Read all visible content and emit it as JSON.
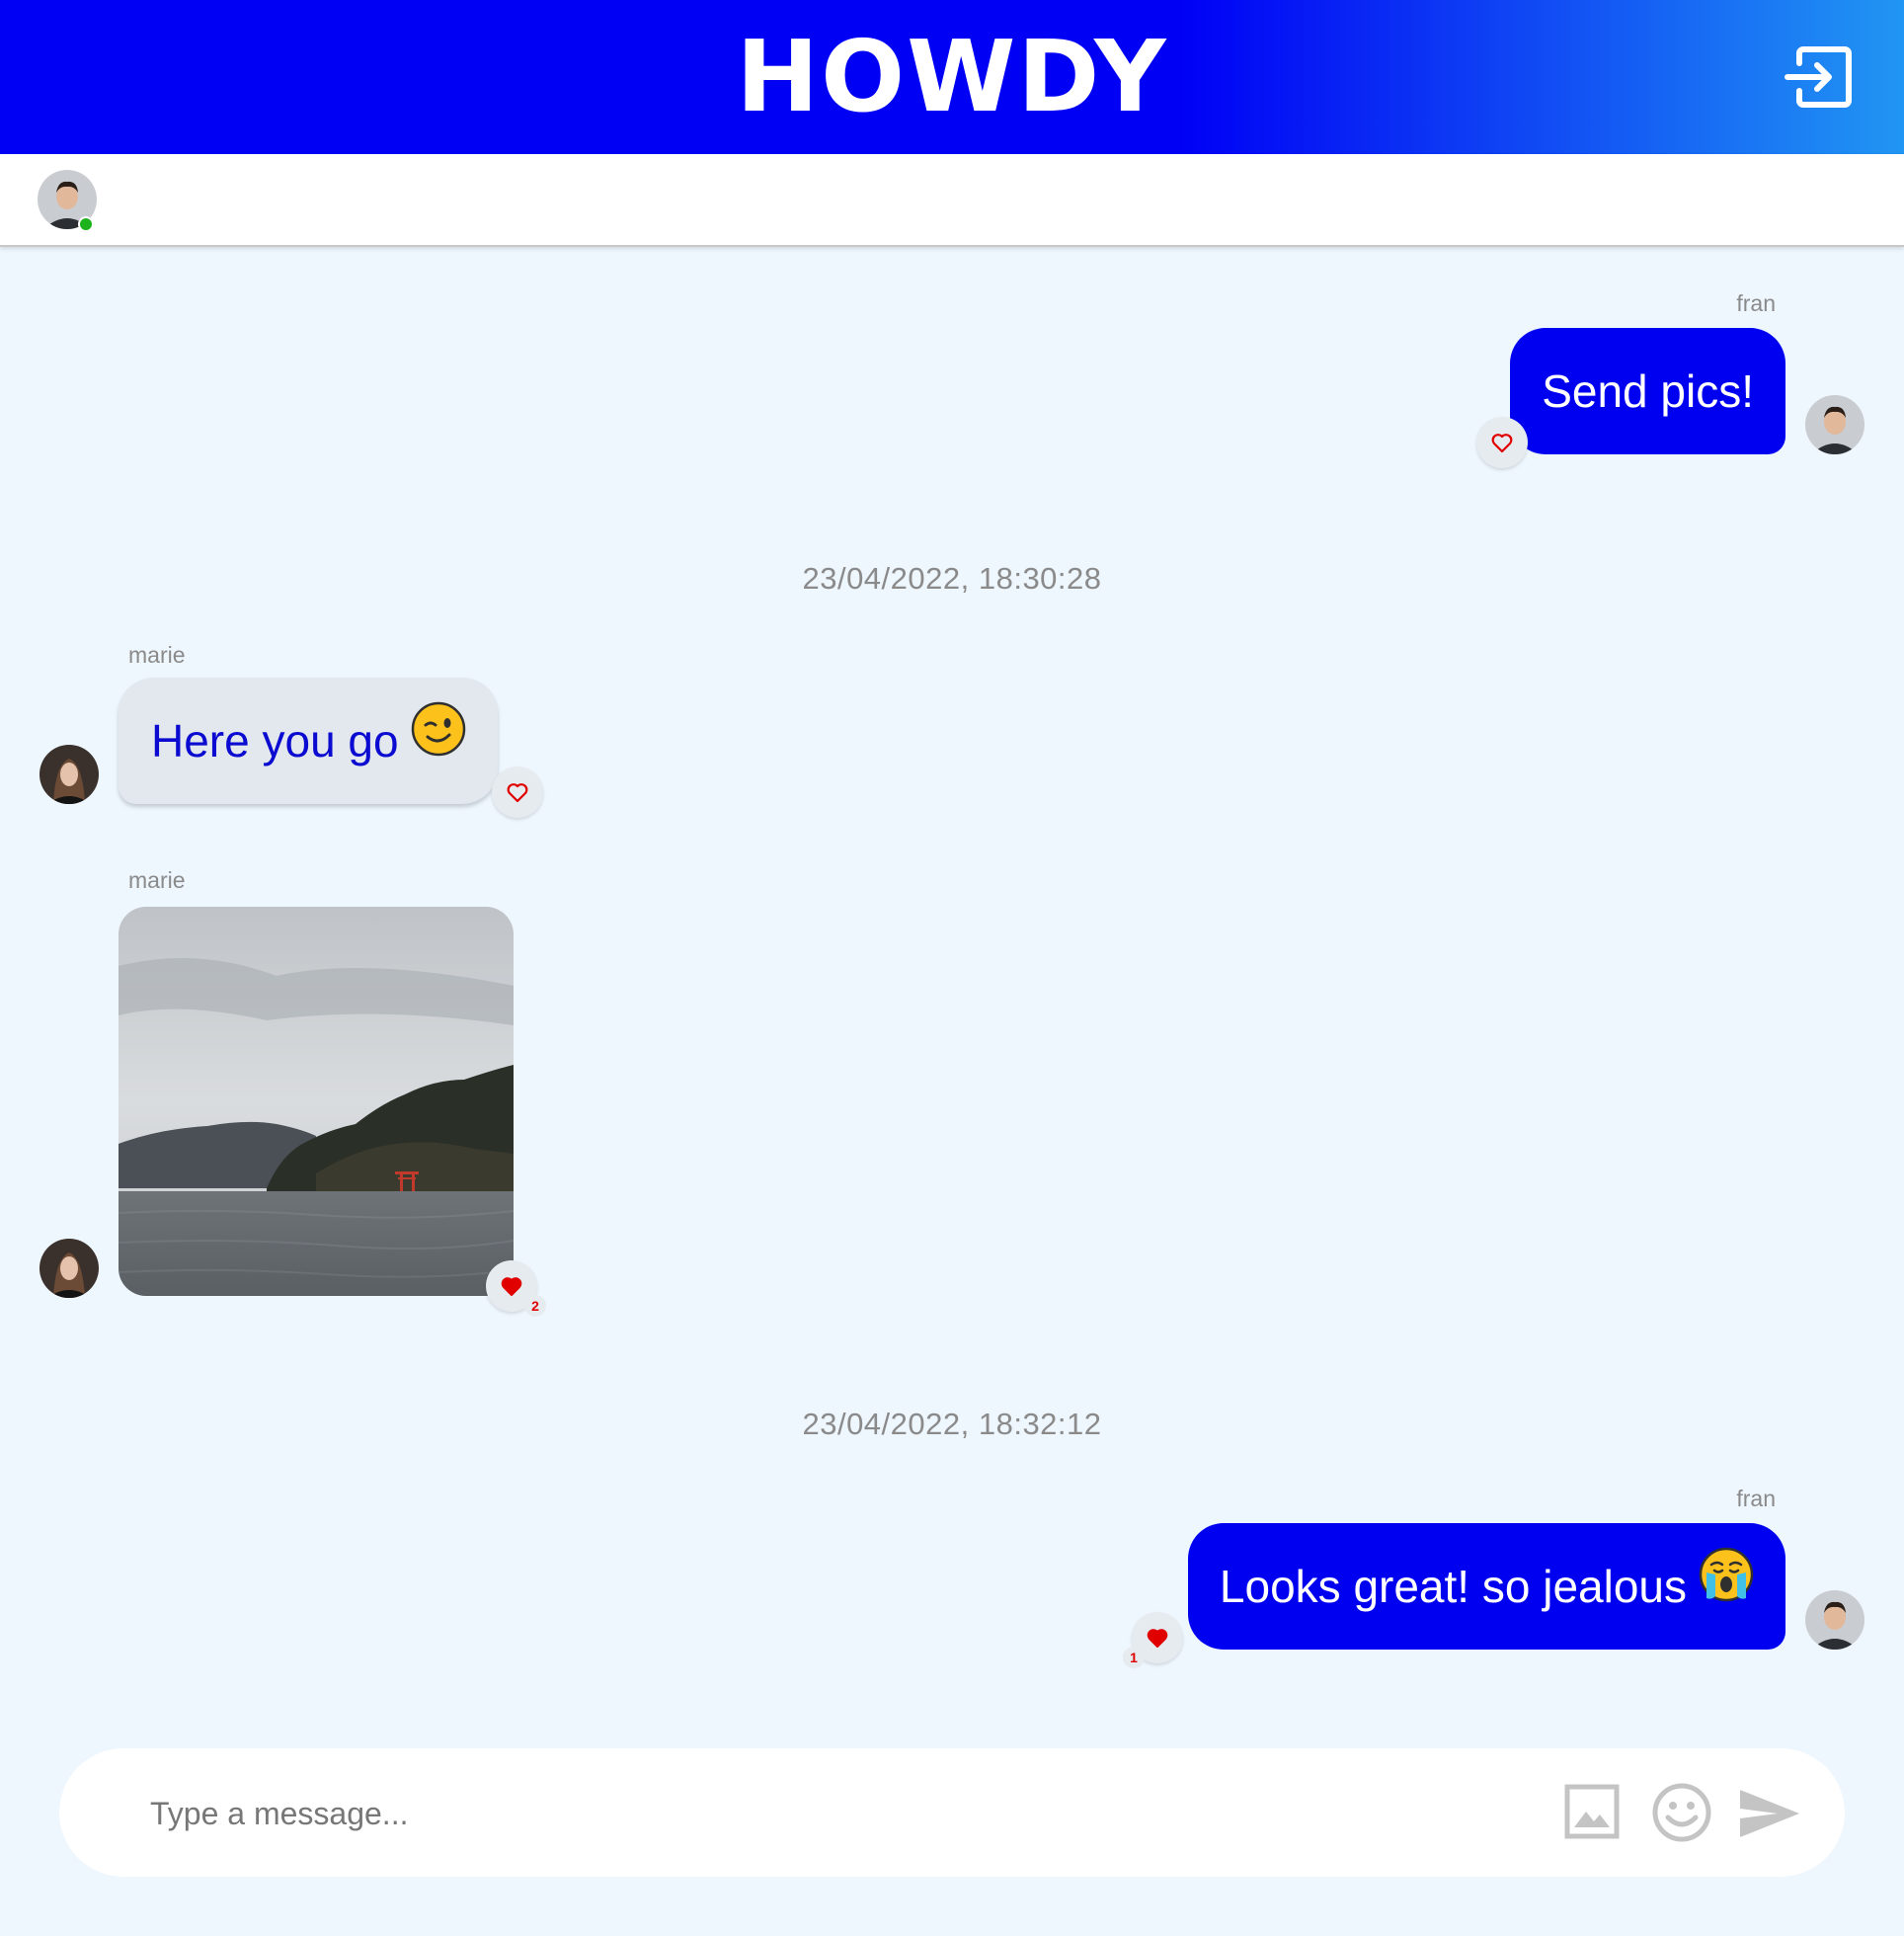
{
  "header": {
    "title": "HOWDY",
    "logout_icon": "logout-icon",
    "gradient": [
      "#0000f5",
      "#2196f3"
    ]
  },
  "colors": {
    "outgoing_bubble": "#0000f0",
    "incoming_bubble": "#e2e8ed",
    "incoming_text": "#0a0ad0",
    "like": "#e00000",
    "background": "#eef6fe",
    "online": "#1db31d"
  },
  "messages": [
    {
      "sender": "fran",
      "text": "Send pics!",
      "emoji": "",
      "liked": false,
      "likes": ""
    },
    {
      "timestamp": "23/04/2022, 18:30:28"
    },
    {
      "sender": "marie",
      "text": "Here you go",
      "emoji": "winking-face",
      "liked": false,
      "likes": ""
    },
    {
      "sender": "marie",
      "image": "lake-with-red-torii-gate",
      "liked": true,
      "likes": "2"
    },
    {
      "timestamp": "23/04/2022, 18:32:12"
    },
    {
      "sender": "fran",
      "text": "Looks great! so jealous",
      "emoji": "crying-face",
      "liked": true,
      "likes": "1"
    }
  ],
  "composer": {
    "placeholder": "Type a message...",
    "value": "",
    "icons": [
      "image-icon",
      "emoji-icon",
      "send-icon"
    ]
  }
}
